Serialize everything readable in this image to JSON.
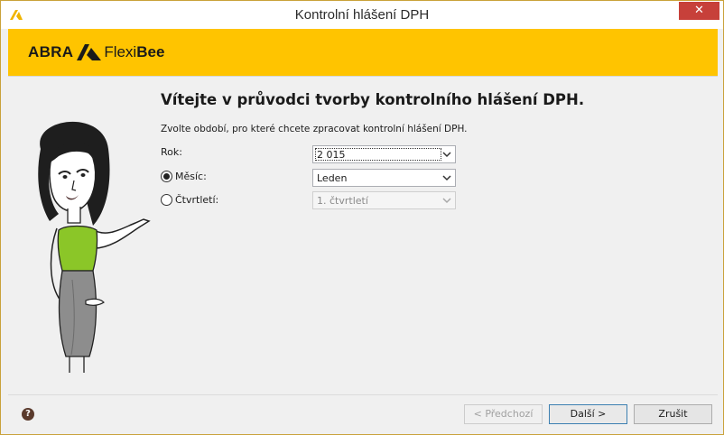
{
  "window": {
    "title": "Kontrolní hlášení DPH",
    "close_glyph": "✕"
  },
  "brand": {
    "abra": "ABRA",
    "flexi": "Flexi",
    "bee": "Bee",
    "band_color": "#ffc400"
  },
  "main": {
    "heading": "Vítejte v průvodci tvorby kontrolního hlášení DPH.",
    "intro": "Zvolte období, pro které chcete zpracovat kontrolní hlášení DPH."
  },
  "form": {
    "year": {
      "label": "Rok:",
      "value": "2 015"
    },
    "month": {
      "label": "Měsíc:",
      "value": "Leden",
      "selected": true
    },
    "quarter": {
      "label": "Čtvrtletí:",
      "value": "1. čtvrtletí",
      "selected": false,
      "disabled": true
    }
  },
  "footer": {
    "help_glyph": "?",
    "back_label": "< Předchozí",
    "next_label": "Další >",
    "cancel_label": "Zrušit"
  },
  "icons": {
    "app": "abra-app-icon",
    "close": "close-icon",
    "help": "help-icon",
    "dropdown": "chevron-down-icon"
  }
}
